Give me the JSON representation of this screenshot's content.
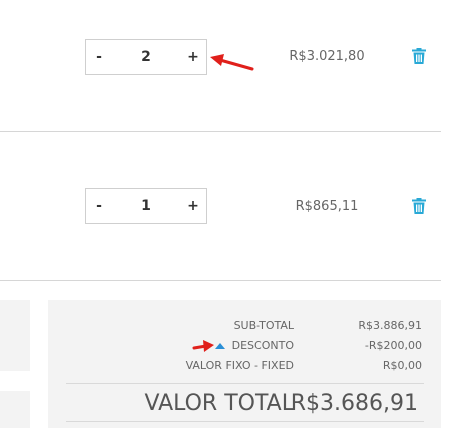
{
  "cart": {
    "items": [
      {
        "decrement_label": "-",
        "quantity": "2",
        "increment_label": "+",
        "price": "R$3.021,80"
      },
      {
        "decrement_label": "-",
        "quantity": "1",
        "increment_label": "+",
        "price": "R$865,11"
      }
    ]
  },
  "summary": {
    "subtotal_label": "SUB-TOTAL",
    "subtotal_value": "R$3.886,91",
    "discount_label": "DESCONTO",
    "discount_value": "-R$200,00",
    "fixed_label": "VALOR FIXO - FIXED",
    "fixed_value": "R$0,00",
    "total_label": "VALOR TOTAL",
    "total_value": "R$3.686,91"
  },
  "colors": {
    "trash_icon": "#29a9d6",
    "annotation_arrow": "#e0201b",
    "discount_toggle": "#2a8fd6",
    "panel_background": "#f3f3f3"
  },
  "icons": {
    "remove_item": "trash-icon",
    "discount_toggle": "triangle-up-icon"
  }
}
